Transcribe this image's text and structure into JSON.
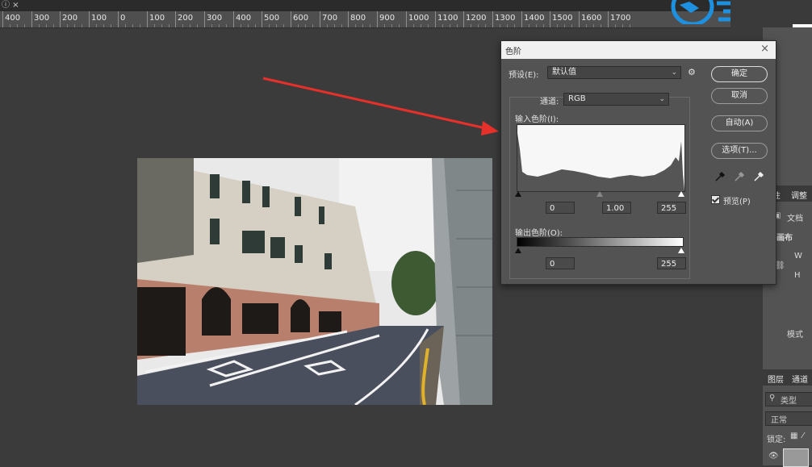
{
  "ruler": {
    "labels": [
      "400",
      "300",
      "200",
      "100",
      "0",
      "100",
      "200",
      "300",
      "400",
      "500",
      "600",
      "700",
      "800",
      "900",
      "1000",
      "1100",
      "1200",
      "1300",
      "1400",
      "1500",
      "1600",
      "1700"
    ]
  },
  "dialog": {
    "title": "色阶",
    "preset_label": "预设(E):",
    "preset_value": "默认值",
    "channel_label": "通道:",
    "channel_value": "RGB",
    "input_levels_label": "输入色阶(I):",
    "input_black": "0",
    "input_gamma": "1.00",
    "input_white": "255",
    "output_levels_label": "输出色阶(O):",
    "output_black": "0",
    "output_white": "255",
    "buttons": {
      "ok": "确定",
      "cancel": "取消",
      "auto": "自动(A)",
      "options": "选项(T)..."
    },
    "preview_label": "预览(P)",
    "preview_checked": true
  },
  "right_panel": {
    "properties_tab": "性",
    "adjust_tab": "调整",
    "doc_label": "文档",
    "canvas_label": "画布",
    "w_label": "W",
    "h_label": "H",
    "mode_label": "模式",
    "layers_tab": "图层",
    "channels_tab": "通道",
    "filter_label": "类型",
    "blend_mode": "正常",
    "lock_label": "锁定:"
  },
  "colors": {
    "annotation_arrow": "#e8302a",
    "watermark": "#1e90e0",
    "foreground_swatch": "#f08da0",
    "accent_blue": "#2a56e0"
  }
}
